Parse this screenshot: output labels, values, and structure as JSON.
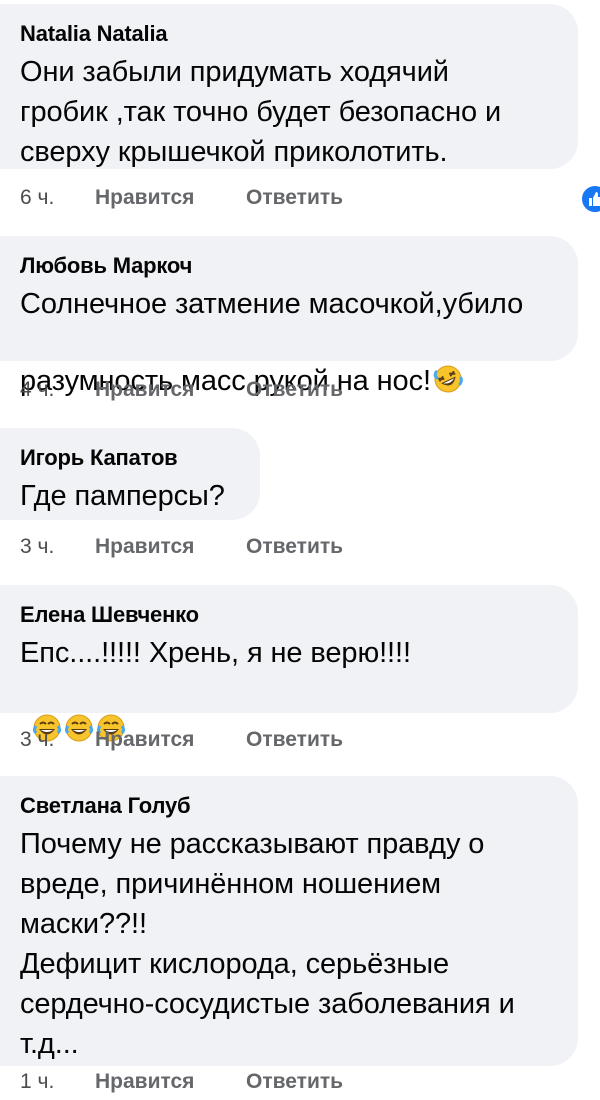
{
  "comments": [
    {
      "author": "Natalia Natalia",
      "text": "Они забыли придумать ходячий\nгробик ,так точно будет безопасно и\nсверху крышечкой приколотить.",
      "time": "6 ч.",
      "like_label": "Нравится",
      "reply_label": "Ответить",
      "reaction_count": "1",
      "reaction_icon": "like-icon"
    },
    {
      "author": "Любовь Маркоч",
      "text": "Солнечное затмение масочкой,убило\nразумность масс рукой на нос!",
      "emoji": "rolling-on-floor-laughing-emoji",
      "time": "4 ч.",
      "like_label": "Нравится",
      "reply_label": "Ответить"
    },
    {
      "author": "Игорь Капатов",
      "text": "Где памперсы?",
      "time": "3 ч.",
      "like_label": "Нравится",
      "reply_label": "Ответить"
    },
    {
      "author": "Елена Шевченко",
      "text": "Епс....!!!!! Хрень, я не верю!!!!",
      "emoji": "face-with-tears-of-joy-emoji",
      "time": "3 ч.",
      "like_label": "Нравится",
      "reply_label": "Ответить"
    },
    {
      "author": "Светлана Голуб",
      "text": "Почему не рассказывают правду о\nвреде, причинённом ношением\nмаски??!!\nДефицит кислорода, серьёзные\nсердечно-сосудистые заболевания и\nт.д...",
      "time": "1 ч.",
      "like_label": "Нравится",
      "reply_label": "Ответить"
    }
  ],
  "colors": {
    "bubble": "#f0f2f5",
    "action_text": "#65676b",
    "like_blue": "#1877f2"
  }
}
